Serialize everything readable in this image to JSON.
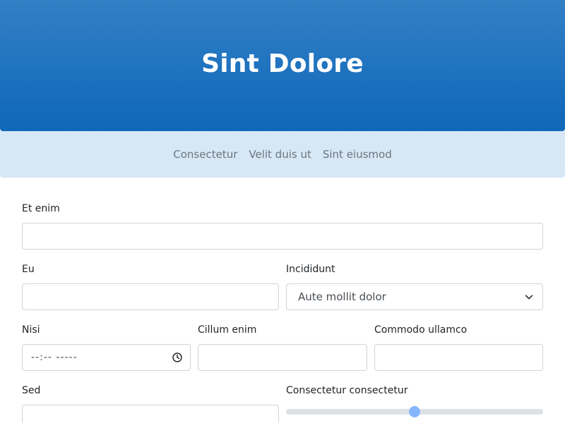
{
  "header": {
    "title": "Sint Dolore"
  },
  "nav": {
    "items": [
      "Consectetur",
      "Velit duis ut",
      "Sint eiusmod"
    ]
  },
  "form": {
    "et_enim": {
      "label": "Et enim",
      "value": ""
    },
    "eu": {
      "label": "Eu",
      "value": ""
    },
    "incididunt": {
      "label": "Incididunt",
      "selected": "Aute mollit dolor"
    },
    "nisi": {
      "label": "Nisi",
      "value": "--:-- -----"
    },
    "cillum_enim": {
      "label": "Cillum enim",
      "value": ""
    },
    "commodo_ullamco": {
      "label": "Commodo ullamco",
      "value": ""
    },
    "sed": {
      "label": "Sed",
      "value": ""
    },
    "range": {
      "label": "Consectetur consectetur",
      "value": 50
    }
  },
  "colors": {
    "header_top": "#3280c5",
    "header_bottom": "#0f67b9",
    "nav_bg": "#d6e7f5",
    "range_thumb": "#86b7fe"
  }
}
